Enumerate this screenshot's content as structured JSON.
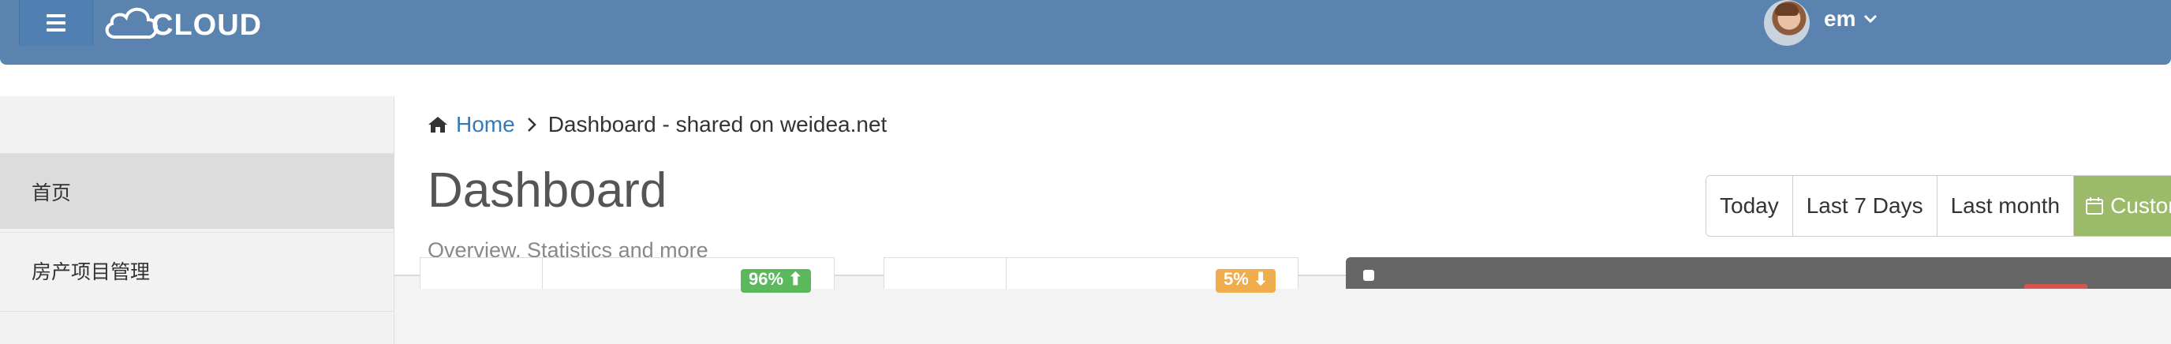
{
  "header": {
    "menu_icon": "hamburger-menu-icon",
    "logo_text": "CLOUD",
    "logo_icon": "cloud-icon",
    "user": {
      "name": "em",
      "caret": "chevron-down-icon"
    },
    "color": "#5a83b0"
  },
  "sidebar": {
    "items": [
      {
        "label": "首页",
        "active": true
      },
      {
        "label": "房产项目管理",
        "active": false
      }
    ]
  },
  "breadcrumb": {
    "home_icon": "home-icon",
    "home": "Home",
    "separator": "›",
    "current": "Dashboard - shared on weidea.net"
  },
  "page": {
    "title": "Dashboard",
    "subtitle": "Overview, Statistics and more"
  },
  "date_range": {
    "buttons": [
      "Today",
      "Last 7 Days",
      "Last month"
    ],
    "custom_label": "Custom",
    "custom_icon": "calendar-icon",
    "accent": "#9bbb6a"
  },
  "stats": {
    "badge1": "96% ⬆",
    "badge1_color": "#5cb85c",
    "badge2": "5% ⬇",
    "badge2_color": "#f0ad4e"
  }
}
